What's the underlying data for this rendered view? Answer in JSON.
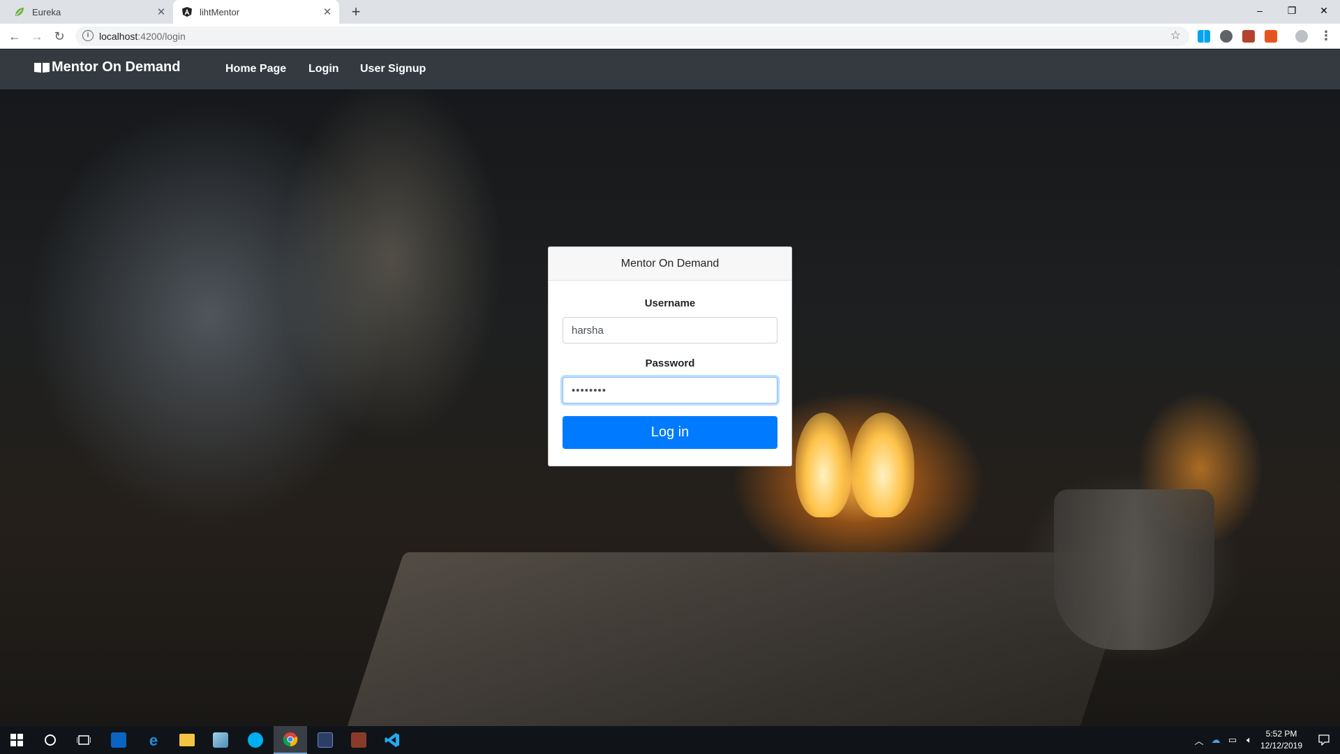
{
  "browser": {
    "tabs": [
      {
        "title": "Eureka",
        "active": false
      },
      {
        "title": "lihtMentor",
        "active": true
      }
    ],
    "new_tab": "+",
    "url_host": "localhost",
    "url_path": ":4200/login",
    "window_controls": {
      "minimize": "–",
      "restore": "❐",
      "close": "✕"
    }
  },
  "app": {
    "brand": "Mentor On Demand",
    "nav": [
      {
        "label": "Home Page"
      },
      {
        "label": "Login"
      },
      {
        "label": "User Signup"
      }
    ]
  },
  "login_card": {
    "header": "Mentor On Demand",
    "username_label": "Username",
    "username_value": "harsha",
    "password_label": "Password",
    "password_value": "••••••••",
    "submit_label": "Log in"
  },
  "taskbar": {
    "time": "5:52 PM",
    "date": "12/12/2019"
  },
  "colors": {
    "navbar": "#343a40",
    "primary": "#007bff",
    "chrome_tabbar": "#dee1e6",
    "taskbar": "#101418"
  }
}
